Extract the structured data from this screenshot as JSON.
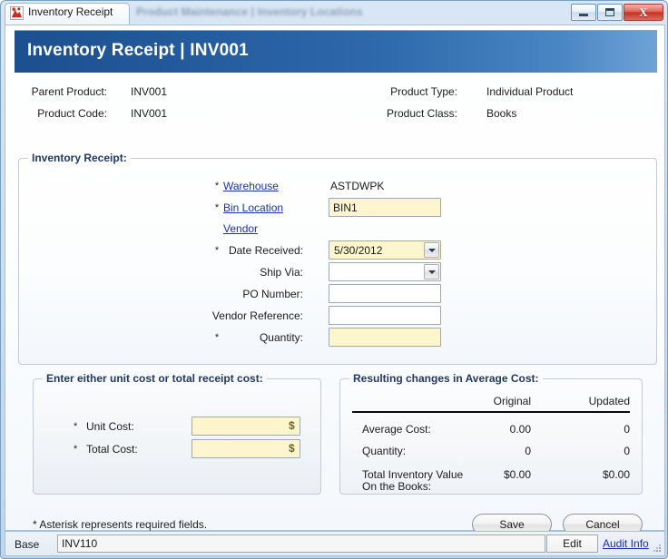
{
  "window": {
    "tab_title": "Inventory Receipt",
    "background_tabs": "Product Maintenance  |  Inventory Locations",
    "app_icon": "app-icon",
    "controls": {
      "minimize": "minimize-button",
      "maximize": "maximize-button",
      "close_glyph": "X"
    }
  },
  "header": {
    "title": "Inventory Receipt  |  INV001",
    "accent_color": "#22589a"
  },
  "summary": {
    "left": [
      {
        "label": "Parent Product:",
        "value": "INV001"
      },
      {
        "label": "Product Code:",
        "value": "INV001"
      }
    ],
    "right": [
      {
        "label": "Product Type:",
        "value": "Individual Product"
      },
      {
        "label": "Product Class:",
        "value": "Books"
      }
    ]
  },
  "receipt_fieldset": {
    "legend": "Inventory Receipt:",
    "fields": {
      "warehouse": {
        "star": "*",
        "label": "Warehouse",
        "value": "ASTDWPK"
      },
      "bin_location": {
        "star": "*",
        "label": "Bin Location",
        "value": "BIN1"
      },
      "vendor": {
        "star": "",
        "label": "Vendor",
        "value": ""
      },
      "date_received": {
        "star": "*",
        "label": "Date Received:",
        "value": "5/30/2012"
      },
      "ship_via": {
        "star": "",
        "label": "Ship Via:",
        "value": ""
      },
      "po_number": {
        "star": "",
        "label": "PO Number:",
        "value": ""
      },
      "vendor_reference": {
        "star": "",
        "label": "Vendor Reference:",
        "value": ""
      },
      "quantity": {
        "star": "*",
        "label": "Quantity:",
        "value": ""
      }
    }
  },
  "cost_fieldset": {
    "legend": "Enter either unit cost or total receipt cost:",
    "rows": [
      {
        "star": "*",
        "label": "Unit Cost:",
        "value": "",
        "suffix": "$"
      },
      {
        "star": "*",
        "label": "Total Cost:",
        "value": "",
        "suffix": "$"
      }
    ]
  },
  "avg_fieldset": {
    "legend": "Resulting changes in Average Cost:",
    "columns": [
      "Original",
      "Updated"
    ],
    "rows": [
      {
        "label": "Average Cost:",
        "original": "0.00",
        "updated": "0"
      },
      {
        "label": "Quantity:",
        "original": "0",
        "updated": "0"
      },
      {
        "label": "Total Inventory Value",
        "label2": "On the Books:",
        "original": "$0.00",
        "updated": "$0.00"
      }
    ]
  },
  "footer": {
    "note": "* Asterisk represents required fields.",
    "save_label": "Save",
    "cancel_label": "Cancel"
  },
  "status_bar": {
    "label": "Base",
    "value": "INV110",
    "edit_label": "Edit",
    "audit_label": "Audit Info"
  }
}
